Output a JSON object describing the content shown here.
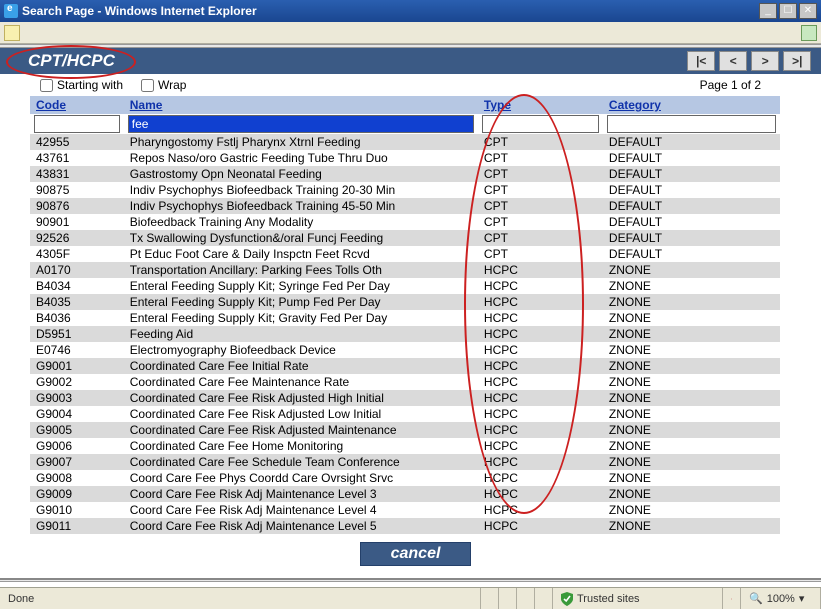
{
  "window": {
    "title": "Search Page - Windows Internet Explorer"
  },
  "heading": "CPT/HCPC",
  "nav": {
    "first": "|<",
    "prev": "<",
    "next": ">",
    "last": ">|"
  },
  "filters": {
    "starting_with_label": "Starting with",
    "wrap_label": "Wrap",
    "page_text": "Page 1 of 2",
    "code_value": "",
    "name_value": "fee",
    "type_value": "",
    "category_value": ""
  },
  "columns": {
    "code": "Code",
    "name": "Name",
    "type": "Type",
    "category": "Category"
  },
  "rows": [
    {
      "code": "42955",
      "name": "Pharyngostomy Fstlj Pharynx Xtrnl Feeding",
      "type": "CPT",
      "category": "DEFAULT"
    },
    {
      "code": "43761",
      "name": "Repos Naso/oro Gastric Feeding Tube Thru Duo",
      "type": "CPT",
      "category": "DEFAULT"
    },
    {
      "code": "43831",
      "name": "Gastrostomy Opn Neonatal Feeding",
      "type": "CPT",
      "category": "DEFAULT"
    },
    {
      "code": "90875",
      "name": "Indiv Psychophys Biofeedback Training 20-30 Min",
      "type": "CPT",
      "category": "DEFAULT"
    },
    {
      "code": "90876",
      "name": "Indiv Psychophys Biofeedback Training 45-50 Min",
      "type": "CPT",
      "category": "DEFAULT"
    },
    {
      "code": "90901",
      "name": "Biofeedback Training Any Modality",
      "type": "CPT",
      "category": "DEFAULT"
    },
    {
      "code": "92526",
      "name": "Tx Swallowing Dysfunction&/oral Funcj Feeding",
      "type": "CPT",
      "category": "DEFAULT"
    },
    {
      "code": "4305F",
      "name": "Pt Educ Foot Care & Daily Inspctn Feet Rcvd",
      "type": "CPT",
      "category": "DEFAULT"
    },
    {
      "code": "A0170",
      "name": "Transportation Ancillary: Parking Fees Tolls Oth",
      "type": "HCPC",
      "category": "ZNONE"
    },
    {
      "code": "B4034",
      "name": "Enteral Feeding Supply Kit; Syringe Fed Per Day",
      "type": "HCPC",
      "category": "ZNONE"
    },
    {
      "code": "B4035",
      "name": "Enteral Feeding Supply Kit; Pump Fed Per Day",
      "type": "HCPC",
      "category": "ZNONE"
    },
    {
      "code": "B4036",
      "name": "Enteral Feeding Supply Kit; Gravity Fed Per Day",
      "type": "HCPC",
      "category": "ZNONE"
    },
    {
      "code": "D5951",
      "name": "Feeding Aid",
      "type": "HCPC",
      "category": "ZNONE"
    },
    {
      "code": "E0746",
      "name": "Electromyography Biofeedback Device",
      "type": "HCPC",
      "category": "ZNONE"
    },
    {
      "code": "G9001",
      "name": "Coordinated Care Fee Initial Rate",
      "type": "HCPC",
      "category": "ZNONE"
    },
    {
      "code": "G9002",
      "name": "Coordinated Care Fee Maintenance Rate",
      "type": "HCPC",
      "category": "ZNONE"
    },
    {
      "code": "G9003",
      "name": "Coordinated Care Fee Risk Adjusted High Initial",
      "type": "HCPC",
      "category": "ZNONE"
    },
    {
      "code": "G9004",
      "name": "Coordinated Care Fee Risk Adjusted Low Initial",
      "type": "HCPC",
      "category": "ZNONE"
    },
    {
      "code": "G9005",
      "name": "Coordinated Care Fee Risk Adjusted Maintenance",
      "type": "HCPC",
      "category": "ZNONE"
    },
    {
      "code": "G9006",
      "name": "Coordinated Care Fee Home Monitoring",
      "type": "HCPC",
      "category": "ZNONE"
    },
    {
      "code": "G9007",
      "name": "Coordinated Care Fee Schedule Team Conference",
      "type": "HCPC",
      "category": "ZNONE"
    },
    {
      "code": "G9008",
      "name": "Coord Care Fee Phys Coordd Care Ovrsight Srvc",
      "type": "HCPC",
      "category": "ZNONE"
    },
    {
      "code": "G9009",
      "name": "Coord Care Fee Risk Adj Maintenance Level 3",
      "type": "HCPC",
      "category": "ZNONE"
    },
    {
      "code": "G9010",
      "name": "Coord Care Fee Risk Adj Maintenance Level 4",
      "type": "HCPC",
      "category": "ZNONE"
    },
    {
      "code": "G9011",
      "name": "Coord Care Fee Risk Adj Maintenance Level 5",
      "type": "HCPC",
      "category": "ZNONE"
    }
  ],
  "cancel_label": "cancel",
  "status": {
    "done": "Done",
    "trusted": "Trusted sites",
    "zoom": "100%"
  }
}
